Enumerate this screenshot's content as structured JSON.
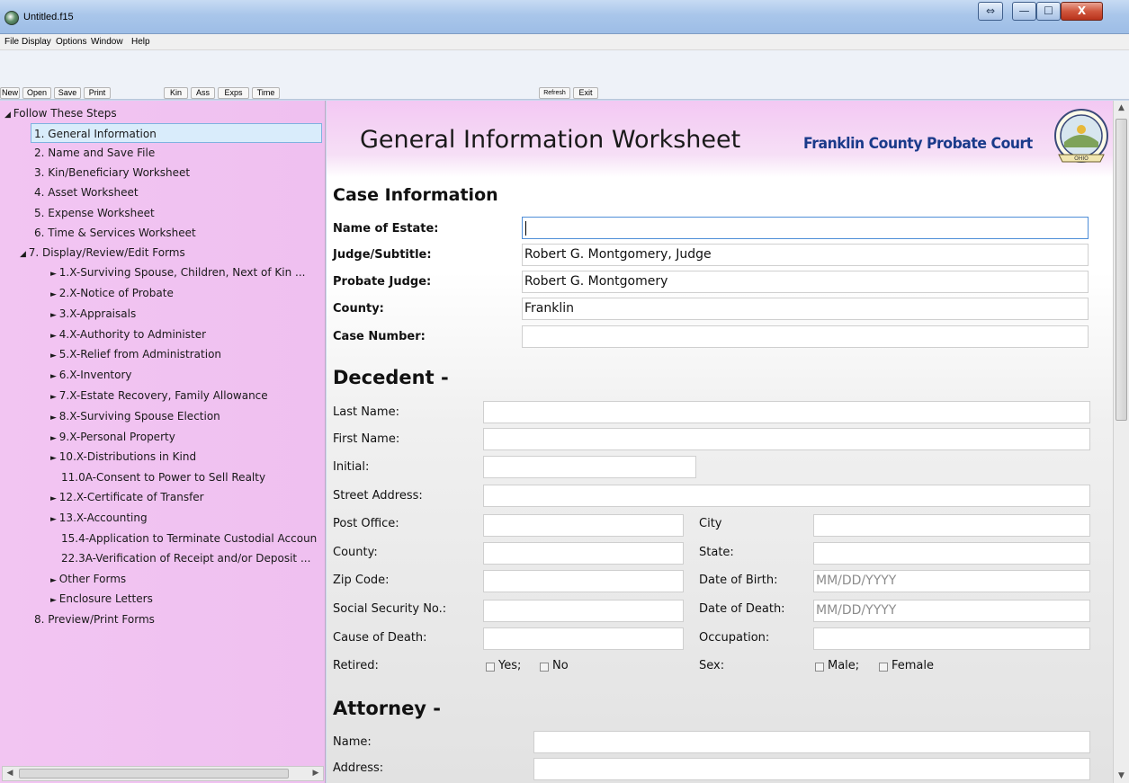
{
  "window": {
    "title": "Untitled.f15",
    "buttons": {
      "help": "⇔",
      "minimize": "—",
      "maximize": "☐",
      "close": "X"
    }
  },
  "menu": [
    "File",
    "Display",
    "Options",
    "Window",
    "Help"
  ],
  "toolbar": {
    "labels": [
      "New",
      "Open",
      "Save",
      "Print",
      "Kin",
      "Ass",
      "Exps",
      "Time",
      "Refresh",
      "Exit"
    ]
  },
  "tree": {
    "root": "Follow These Steps",
    "items": [
      "1. General Information",
      "2. Name and Save File",
      "3. Kin/Beneficiary Worksheet",
      "4. Asset Worksheet",
      "5. Expense Worksheet",
      "6. Time & Services Worksheet",
      "7. Display/Review/Edit Forms",
      "1.X-Surviving Spouse, Children, Next of Kin ...",
      "2.X-Notice of Probate",
      "3.X-Appraisals",
      "4.X-Authority to Administer",
      "5.X-Relief from Administration",
      "6.X-Inventory",
      "7.X-Estate Recovery, Family Allowance",
      "8.X-Surviving Spouse Election",
      "9.X-Personal Property",
      "10.X-Distributions in Kind",
      "11.0A-Consent to Power to Sell Realty",
      "12.X-Certificate of Transfer",
      "13.X-Accounting",
      "15.4-Application to Terminate Custodial Accoun",
      "22.3A-Verification of Receipt and/or Deposit ...",
      "Other Forms",
      "Enclosure Letters",
      "8. Preview/Print Forms"
    ]
  },
  "header": {
    "title": "General Information Worksheet",
    "court": "Franklin County Probate Court",
    "seal_text": "OHIO"
  },
  "case_info": {
    "title": "Case Information",
    "name_of_estate_label": "Name of Estate:",
    "name_of_estate_value": "",
    "judge_subtitle_label": "Judge/Subtitle:",
    "judge_subtitle_value": "Robert G. Montgomery, Judge",
    "probate_judge_label": "Probate Judge:",
    "probate_judge_value": "Robert G. Montgomery",
    "county_label": "County:",
    "county_value": "Franklin",
    "case_number_label": "Case Number:",
    "case_number_value": ""
  },
  "decedent": {
    "title": "Decedent -",
    "last_name": "Last Name:",
    "first_name": "First Name:",
    "initial": "Initial:",
    "street_address": "Street Address:",
    "post_office": "Post Office:",
    "city": "City",
    "county": "County:",
    "state": "State:",
    "zip_code": "Zip Code:",
    "date_of_birth": "Date of Birth:",
    "date_of_birth_placeholder": "MM/DD/YYYY",
    "ssn": "Social Security No.:",
    "date_of_death": "Date of Death:",
    "date_of_death_placeholder": "MM/DD/YYYY",
    "cause_of_death": "Cause of Death:",
    "occupation": "Occupation:",
    "retired": "Retired:",
    "retired_yes": "Yes;",
    "retired_no": "No",
    "sex": "Sex:",
    "sex_male": "Male;",
    "sex_female": "Female"
  },
  "attorney": {
    "title": "Attorney -",
    "name": "Name:",
    "address": "Address:"
  }
}
